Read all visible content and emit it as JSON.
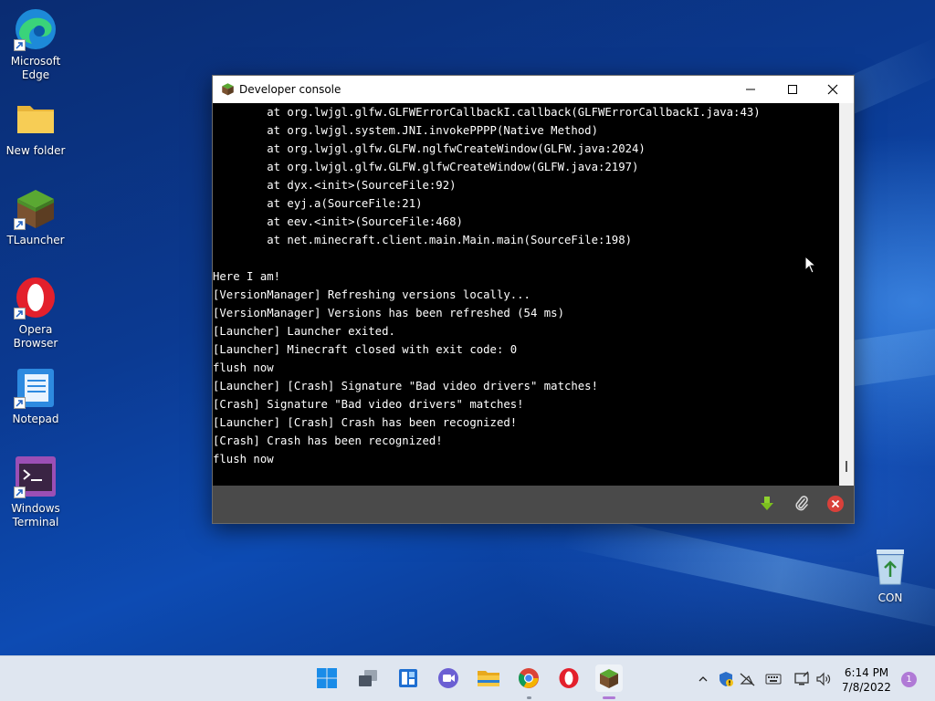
{
  "desktop": {
    "icons": [
      {
        "label": "Microsoft Edge",
        "icon": "edge-icon"
      },
      {
        "label": "New folder",
        "icon": "folder-icon"
      },
      {
        "label": "TLauncher",
        "icon": "tlauncher-icon"
      },
      {
        "label": "Opera Browser",
        "icon": "opera-icon"
      },
      {
        "label": "Notepad",
        "icon": "notepad-icon"
      },
      {
        "label": "Windows Terminal",
        "icon": "terminal-icon"
      },
      {
        "label": "CON",
        "icon": "recycle-bin-icon"
      }
    ]
  },
  "window": {
    "title": "Developer console",
    "console_lines": [
      "        at org.lwjgl.glfw.GLFWErrorCallbackI.callback(GLFWErrorCallbackI.java:43)",
      "        at org.lwjgl.system.JNI.invokePPPP(Native Method)",
      "        at org.lwjgl.glfw.GLFW.nglfwCreateWindow(GLFW.java:2024)",
      "        at org.lwjgl.glfw.GLFW.glfwCreateWindow(GLFW.java:2197)",
      "        at dyx.<init>(SourceFile:92)",
      "        at eyj.a(SourceFile:21)",
      "        at eev.<init>(SourceFile:468)",
      "        at net.minecraft.client.main.Main.main(SourceFile:198)",
      "",
      "Here I am!",
      "[VersionManager] Refreshing versions locally...",
      "[VersionManager] Versions has been refreshed (54 ms)",
      "[Launcher] Launcher exited.",
      "[Launcher] Minecraft closed with exit code: 0",
      "flush now",
      "[Launcher] [Crash] Signature \"Bad video drivers\" matches!",
      "[Crash] Signature \"Bad video drivers\" matches!",
      "[Launcher] [Crash] Crash has been recognized!",
      "[Crash] Crash has been recognized!",
      "flush now"
    ],
    "buttons": [
      "download-icon",
      "attach-icon",
      "close-circle-icon"
    ]
  },
  "taskbar": {
    "apps": [
      "windows-start-icon",
      "task-view-icon",
      "widgets-icon",
      "chat-icon",
      "file-explorer-icon",
      "chrome-icon",
      "opera-icon",
      "tlauncher-icon"
    ],
    "tray": [
      "chevron-up-icon",
      "security-icon",
      "network-off-icon",
      "keyboard-icon",
      "display-icon",
      "volume-icon"
    ],
    "time": "6:14 PM",
    "date": "7/8/2022",
    "notifications": "1"
  },
  "colors": {
    "console_bg": "#000000",
    "console_fg": "#ffffff",
    "bottombar": "#4a4a4a",
    "taskbar": "#dfe6f0"
  }
}
